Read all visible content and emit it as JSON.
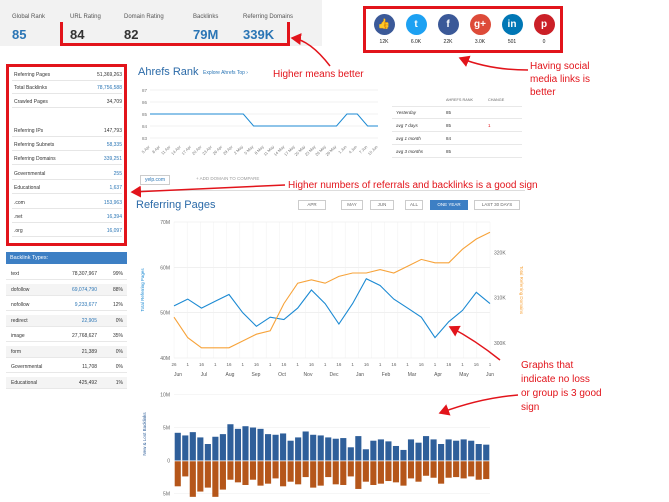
{
  "metrics": [
    {
      "label": "Global Rank",
      "value": "85",
      "color": "#2a75b5"
    },
    {
      "label": "URL Rating",
      "value": "84",
      "color": "#333333"
    },
    {
      "label": "Domain Rating",
      "value": "82",
      "color": "#333333"
    },
    {
      "label": "Backlinks",
      "value": "79M",
      "color": "#2a75b5"
    },
    {
      "label": "Referring Domains",
      "value": "339K",
      "color": "#2a75b5"
    }
  ],
  "social": [
    {
      "icon": "thumbs-up-icon",
      "glyph": "👍",
      "count": "12K",
      "color": "#3b5998"
    },
    {
      "icon": "twitter-icon",
      "glyph": "t",
      "count": "6.0K",
      "color": "#1da1f2"
    },
    {
      "icon": "facebook-icon",
      "glyph": "f",
      "count": "22K",
      "color": "#3b5998"
    },
    {
      "icon": "google-plus-icon",
      "glyph": "g+",
      "count": "3.0K",
      "color": "#dd4b39"
    },
    {
      "icon": "linkedin-icon",
      "glyph": "in",
      "count": "501",
      "color": "#0077b5"
    },
    {
      "icon": "pinterest-icon",
      "glyph": "p",
      "count": "0",
      "color": "#cb2027"
    }
  ],
  "stats": [
    {
      "label": "Referring Pages",
      "value": "51,369,263",
      "blue": false
    },
    {
      "label": "Total Backlinks",
      "value": "78,756,588",
      "blue": true
    },
    {
      "label": "Crawled Pages",
      "value": "34,709",
      "blue": false
    },
    {
      "label": "Referring IPs",
      "value": "147,793",
      "blue": false
    },
    {
      "label": "Referring Subnets",
      "value": "58,335",
      "blue": true
    },
    {
      "label": "Referring Domains",
      "value": "339,251",
      "blue": true
    },
    {
      "label": "Governmental",
      "value": "255",
      "blue": true
    },
    {
      "label": "Educational",
      "value": "1,637",
      "blue": true
    },
    {
      "label": ".com",
      "value": "153,963",
      "blue": true
    },
    {
      "label": ".net",
      "value": "16,394",
      "blue": true
    },
    {
      "label": ".org",
      "value": "16,097",
      "blue": true
    }
  ],
  "backlink_types": {
    "header": "Backlink Types:",
    "rows": [
      {
        "label": "text",
        "value": "78,307,967",
        "pct": "99%",
        "blue": false
      },
      {
        "label": "dofollow",
        "value": "69,074,790",
        "pct": "88%",
        "blue": true
      },
      {
        "label": "nofollow",
        "value": "9,233,677",
        "pct": "12%",
        "blue": true
      },
      {
        "label": "redirect",
        "value": "22,905",
        "pct": "0%",
        "blue": true
      },
      {
        "label": "image",
        "value": "27,768,627",
        "pct": "35%",
        "blue": false
      },
      {
        "label": "form",
        "value": "21,389",
        "pct": "0%",
        "blue": false
      },
      {
        "label": "Governmental",
        "value": "11,708",
        "pct": "0%",
        "blue": false
      },
      {
        "label": "Educational",
        "value": "425,492",
        "pct": "1%",
        "blue": false
      }
    ]
  },
  "ahrefs_rank": {
    "title": "Ahrefs Rank",
    "link": "Explore Ahrefs Top ›",
    "domain_tag": "yelp.com",
    "add_domain": "+ ADD DOMAIN TO COMPARE",
    "table_headers": [
      "AHREFS RANK",
      "CHANGE"
    ],
    "table": [
      {
        "period": "Yesterday",
        "rank": "85",
        "change": ""
      },
      {
        "period": "avg 7 days",
        "rank": "85",
        "change": "1"
      },
      {
        "period": "avg 1 month",
        "rank": "84",
        "change": ""
      },
      {
        "period": "avg 3 months",
        "rank": "85",
        "change": ""
      }
    ],
    "chart_data": {
      "type": "line",
      "x": [
        "5 Apr",
        "8 Apr",
        "11 Apr",
        "14 Apr",
        "17 Apr",
        "20 Apr",
        "23 Apr",
        "26 Apr",
        "29 Apr",
        "2 May",
        "5 May",
        "8 May",
        "11 May",
        "14 May",
        "17 May",
        "20 May",
        "23 May",
        "26 May",
        "29 May",
        "1 Jun",
        "4 Jun",
        "7 Jun",
        "10 Jun"
      ],
      "y": [
        85,
        85,
        85,
        85,
        85,
        85,
        85,
        85,
        85,
        85,
        84,
        84,
        84,
        84,
        84,
        84,
        84,
        84,
        84,
        85,
        85,
        84,
        84
      ],
      "yticks": [
        "83",
        "84",
        "85",
        "86",
        "87"
      ],
      "ylim": [
        83,
        87
      ]
    }
  },
  "referring_pages": {
    "title": "Referring Pages",
    "tabs": [
      "APR",
      "MAY",
      "JUN",
      "ALL",
      "ONE YEAR",
      "LAST 30 DAYS"
    ],
    "active_tab": "ONE YEAR",
    "chart_data": {
      "type": "line",
      "left_axis_label": "Total Referring Pages",
      "right_axis_label": "Total Referring Domains",
      "left_ticks": [
        "40M",
        "50M",
        "60M",
        "70M"
      ],
      "right_ticks": [
        "300K",
        "310K",
        "320K",
        "330K"
      ],
      "left_ylim": [
        40000000,
        70000000
      ],
      "right_ylim": [
        290000,
        330000
      ],
      "x_day_ticks": [
        "26",
        "1",
        "16",
        "1",
        "16",
        "1",
        "16",
        "1",
        "16",
        "1",
        "16",
        "1",
        "16",
        "1",
        "16",
        "1",
        "16",
        "1",
        "16",
        "1",
        "16",
        "1",
        "16",
        "1"
      ],
      "x_month_ticks": [
        "Jun",
        "Jul",
        "Aug",
        "Sep",
        "Oct",
        "Nov",
        "Dec",
        "Jan",
        "Feb",
        "Mar",
        "Apr",
        "May",
        "Jun"
      ],
      "series": [
        {
          "name": "Total Referring Pages",
          "axis": "left",
          "color": "#1c8ad3",
          "values": [
            51.5,
            53.0,
            51.0,
            52.5,
            54.0,
            50.0,
            47.0,
            49.0,
            48.5,
            51.0,
            55.0,
            52.0,
            47.5,
            52.0,
            57.5,
            56.0,
            53.0,
            51.0,
            49.0,
            44.5,
            48.0,
            50.5,
            54.5,
            52.0
          ]
        },
        {
          "name": "Total Referring Domains",
          "axis": "right",
          "color": "#f7a33a",
          "values": [
            302,
            296,
            293,
            293,
            293,
            295,
            297,
            298,
            306,
            312,
            313,
            312,
            314,
            315,
            315,
            316,
            315,
            317,
            319,
            318,
            318,
            322,
            325,
            327
          ]
        }
      ]
    }
  },
  "new_lost": {
    "axis_label": "New & Lost Backlinks",
    "ticks": [
      "10M",
      "5M",
      "0",
      "5M"
    ],
    "chart_data": {
      "type": "bar",
      "new_color": "#2f5f9a",
      "lost_color": "#b5561a",
      "new": [
        4.2,
        3.8,
        4.3,
        3.5,
        2.5,
        3.6,
        4.0,
        5.5,
        4.8,
        5.2,
        5.0,
        4.8,
        4.0,
        3.9,
        4.1,
        3.0,
        3.5,
        4.4,
        3.9,
        3.8,
        3.5,
        3.3,
        3.4,
        2.0,
        3.7,
        1.7,
        3.0,
        3.2,
        2.9,
        2.2,
        1.6,
        3.2,
        2.7,
        3.7,
        3.2,
        2.5,
        3.2,
        3.0,
        3.2,
        3.0,
        2.5,
        2.4
      ],
      "lost": [
        3.8,
        2.3,
        5.4,
        4.6,
        4.0,
        5.4,
        4.3,
        2.8,
        3.2,
        3.6,
        2.8,
        3.7,
        3.4,
        2.6,
        3.8,
        3.1,
        3.5,
        2.4,
        4.0,
        3.7,
        2.4,
        3.5,
        3.6,
        2.3,
        4.2,
        3.1,
        3.6,
        3.4,
        3.0,
        3.2,
        3.7,
        2.6,
        3.1,
        2.2,
        2.5,
        3.4,
        2.5,
        2.4,
        2.6,
        2.3,
        2.8,
        2.7
      ],
      "ylim": [
        -6,
        11
      ]
    }
  },
  "annotations": {
    "higher_better": "Higher means better",
    "social": [
      "Having social",
      "media links is",
      "better"
    ],
    "referrals": "Higher numbers of referrals and backlinks is a good sign",
    "graphs": [
      "Graphs that",
      "indicate no loss",
      "or group is 3 good",
      "sign"
    ]
  }
}
